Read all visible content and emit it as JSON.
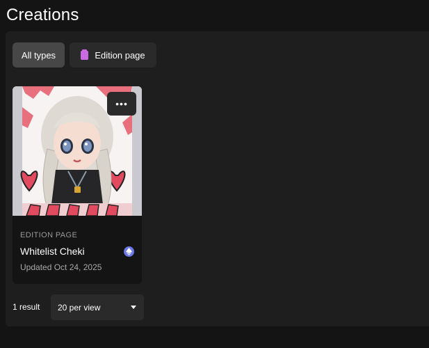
{
  "page": {
    "title": "Creations"
  },
  "filters": [
    {
      "label": "All types",
      "selected": true
    },
    {
      "label": "Edition page",
      "icon": "edition-page-icon",
      "icon_color": "#c86be0"
    }
  ],
  "card": {
    "type_label": "EDITION PAGE",
    "title": "Whitelist Cheki",
    "updated": "Updated Oct 24, 2025",
    "more_label": "•••",
    "chain_icon": "ethereum-icon",
    "chain_color": "#6b77e8"
  },
  "pagination": {
    "result_count": "1 result",
    "per_view": "20 per view"
  }
}
